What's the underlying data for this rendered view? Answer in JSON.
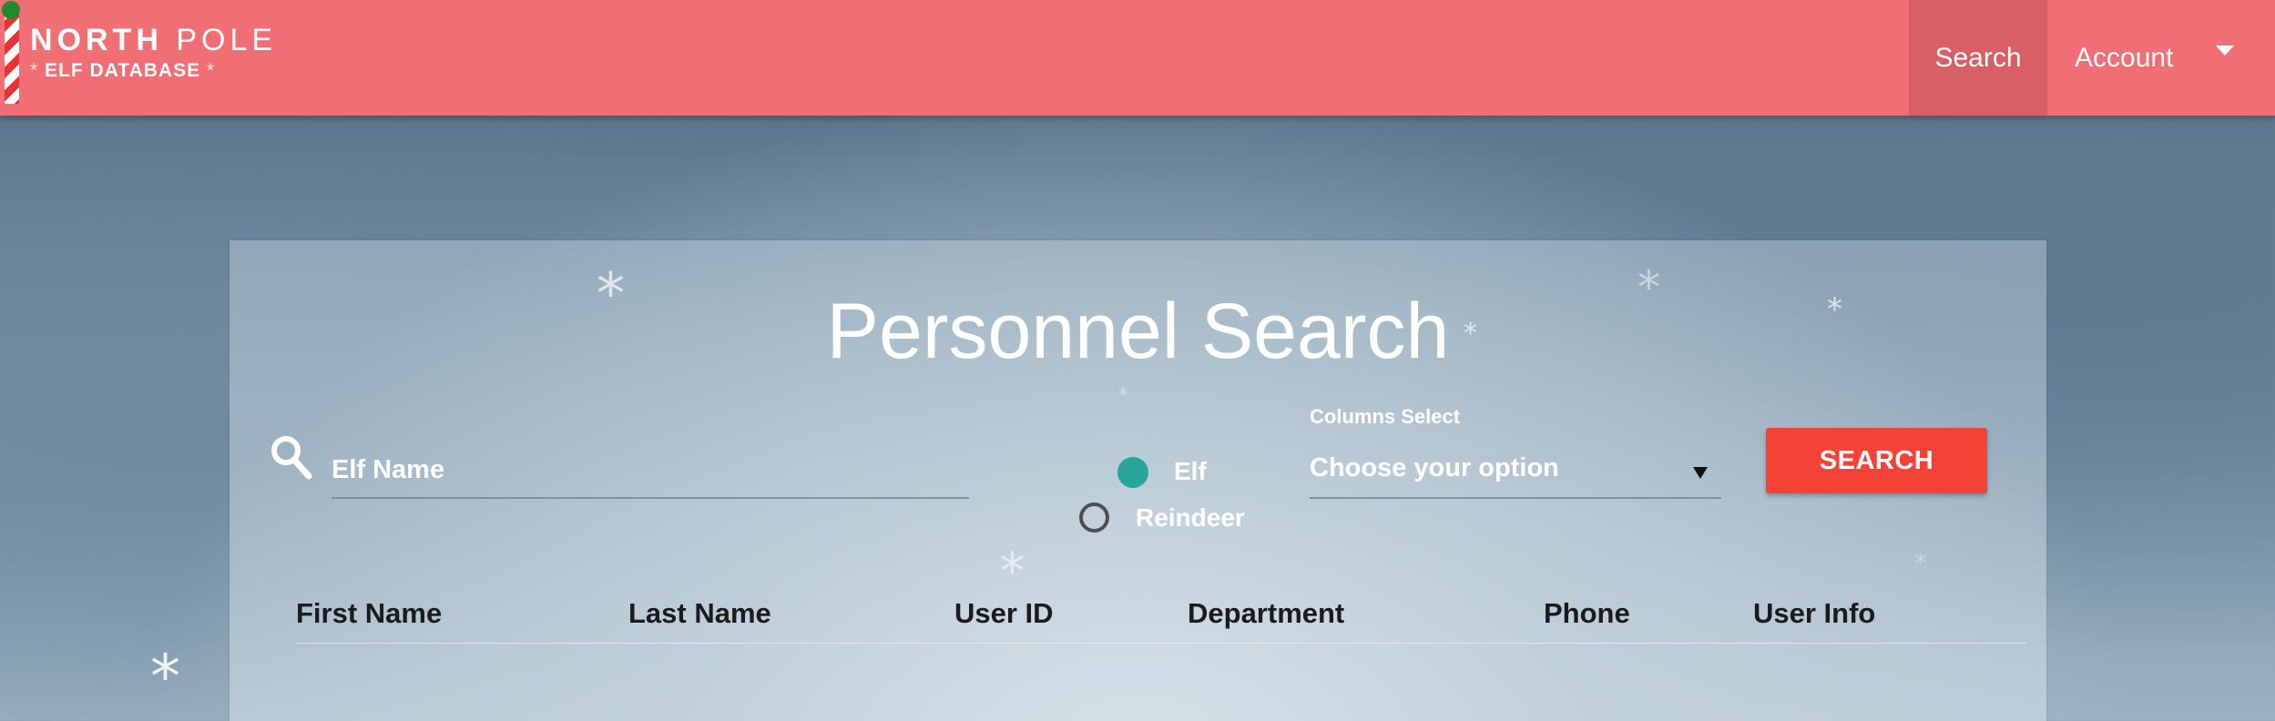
{
  "header": {
    "logo": {
      "line1_bold": "NORTH",
      "line1_light": "POLE",
      "line2": "ELF DATABASE",
      "line2_star": "*"
    },
    "nav": {
      "search": "Search",
      "account": "Account"
    }
  },
  "main": {
    "title": "Personnel Search",
    "search": {
      "placeholder": "Elf Name"
    },
    "type_options": [
      {
        "label": "Elf",
        "selected": true
      },
      {
        "label": "Reindeer",
        "selected": false
      }
    ],
    "columns_select": {
      "label": "Columns Select",
      "value": "Choose your option"
    },
    "search_button": "SEARCH",
    "table": {
      "columns": [
        "First Name",
        "Last Name",
        "User ID",
        "Department",
        "Phone",
        "User Info"
      ]
    }
  },
  "colors": {
    "header_bg": "#f06e74",
    "nav_active_bg": "#d75f65",
    "accent_teal": "#26a69a",
    "button_red": "#f44336"
  },
  "icons": [
    "candy-cane-pole-icon",
    "search-icon",
    "caret-down-icon",
    "select-arrow-icon",
    "snowflake-icon"
  ]
}
